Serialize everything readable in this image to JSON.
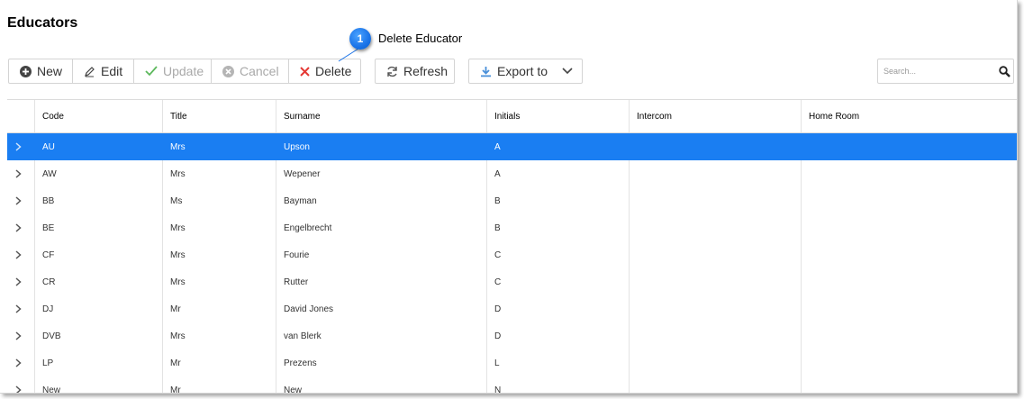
{
  "page": {
    "title": "Educators"
  },
  "callout": {
    "number": "1",
    "text": "Delete Educator"
  },
  "toolbar": {
    "new_label": "New",
    "edit_label": "Edit",
    "update_label": "Update",
    "cancel_label": "Cancel",
    "delete_label": "Delete",
    "refresh_label": "Refresh",
    "export_label": "Export to"
  },
  "search": {
    "placeholder": "Search..."
  },
  "colors": {
    "accent": "#1a7ef2",
    "delete": "#e53935",
    "update": "#5cb85c",
    "callout": "#1a73e8"
  },
  "grid": {
    "columns": [
      "Code",
      "Title",
      "Surname",
      "Initials",
      "Intercom",
      "Home Room"
    ],
    "rows": [
      {
        "code": "AU",
        "title": "Mrs",
        "surname": "Upson",
        "initials": "A",
        "intercom": "",
        "home_room": ""
      },
      {
        "code": "AW",
        "title": "Mrs",
        "surname": "Wepener",
        "initials": "A",
        "intercom": "",
        "home_room": ""
      },
      {
        "code": "BB",
        "title": "Ms",
        "surname": "Bayman",
        "initials": "B",
        "intercom": "",
        "home_room": ""
      },
      {
        "code": "BE",
        "title": "Mrs",
        "surname": "Engelbrecht",
        "initials": "B",
        "intercom": "",
        "home_room": ""
      },
      {
        "code": "CF",
        "title": "Mrs",
        "surname": "Fourie",
        "initials": "C",
        "intercom": "",
        "home_room": ""
      },
      {
        "code": "CR",
        "title": "Mrs",
        "surname": "Rutter",
        "initials": "C",
        "intercom": "",
        "home_room": ""
      },
      {
        "code": "DJ",
        "title": "Mr",
        "surname": "David Jones",
        "initials": "D",
        "intercom": "",
        "home_room": ""
      },
      {
        "code": "DVB",
        "title": "Mrs",
        "surname": "van Blerk",
        "initials": "D",
        "intercom": "",
        "home_room": ""
      },
      {
        "code": "LP",
        "title": "Mr",
        "surname": "Prezens",
        "initials": "L",
        "intercom": "",
        "home_room": ""
      },
      {
        "code": "New",
        "title": "Mr",
        "surname": "New",
        "initials": "N",
        "intercom": "",
        "home_room": ""
      }
    ]
  }
}
